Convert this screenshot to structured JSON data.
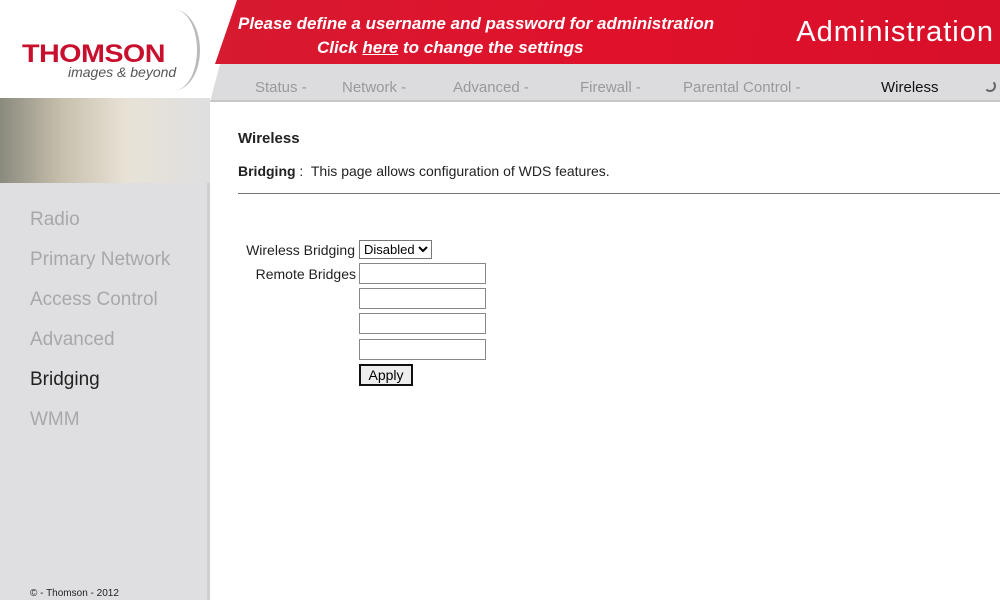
{
  "logo": {
    "brand": "THOMSON",
    "tagline": "images & beyond"
  },
  "banner": {
    "line1": "Please define a username and password for administration",
    "line2_pre": "Click ",
    "line2_link": "here",
    "line2_post": " to change the settings",
    "section": "Administration"
  },
  "nav": {
    "tabs": [
      {
        "label": "Status -"
      },
      {
        "label": "Network -"
      },
      {
        "label": "Advanced -"
      },
      {
        "label": "Firewall -"
      },
      {
        "label": "Parental Control -"
      },
      {
        "label": "Wireless"
      }
    ],
    "active": "Wireless"
  },
  "sidebar": {
    "items": [
      {
        "label": "Radio"
      },
      {
        "label": "Primary Network"
      },
      {
        "label": "Access Control"
      },
      {
        "label": "Advanced"
      },
      {
        "label": "Bridging"
      },
      {
        "label": "WMM"
      }
    ],
    "active": "Bridging",
    "footer": "© - Thomson - 2012"
  },
  "page": {
    "title": "Wireless",
    "desc_label": "Bridging",
    "desc_sep": " : ",
    "desc_text": "This page allows configuration of WDS features."
  },
  "form": {
    "wireless_bridging_label": "Wireless Bridging",
    "wireless_bridging_value": "Disabled",
    "remote_bridges_label": "Remote Bridges",
    "remote_bridges": [
      "",
      "",
      "",
      ""
    ],
    "apply_label": "Apply"
  },
  "colors": {
    "brand_red": "#e0112b",
    "nav_bg": "#dcdcde",
    "sidebar_bg": "#dfdfe1"
  }
}
